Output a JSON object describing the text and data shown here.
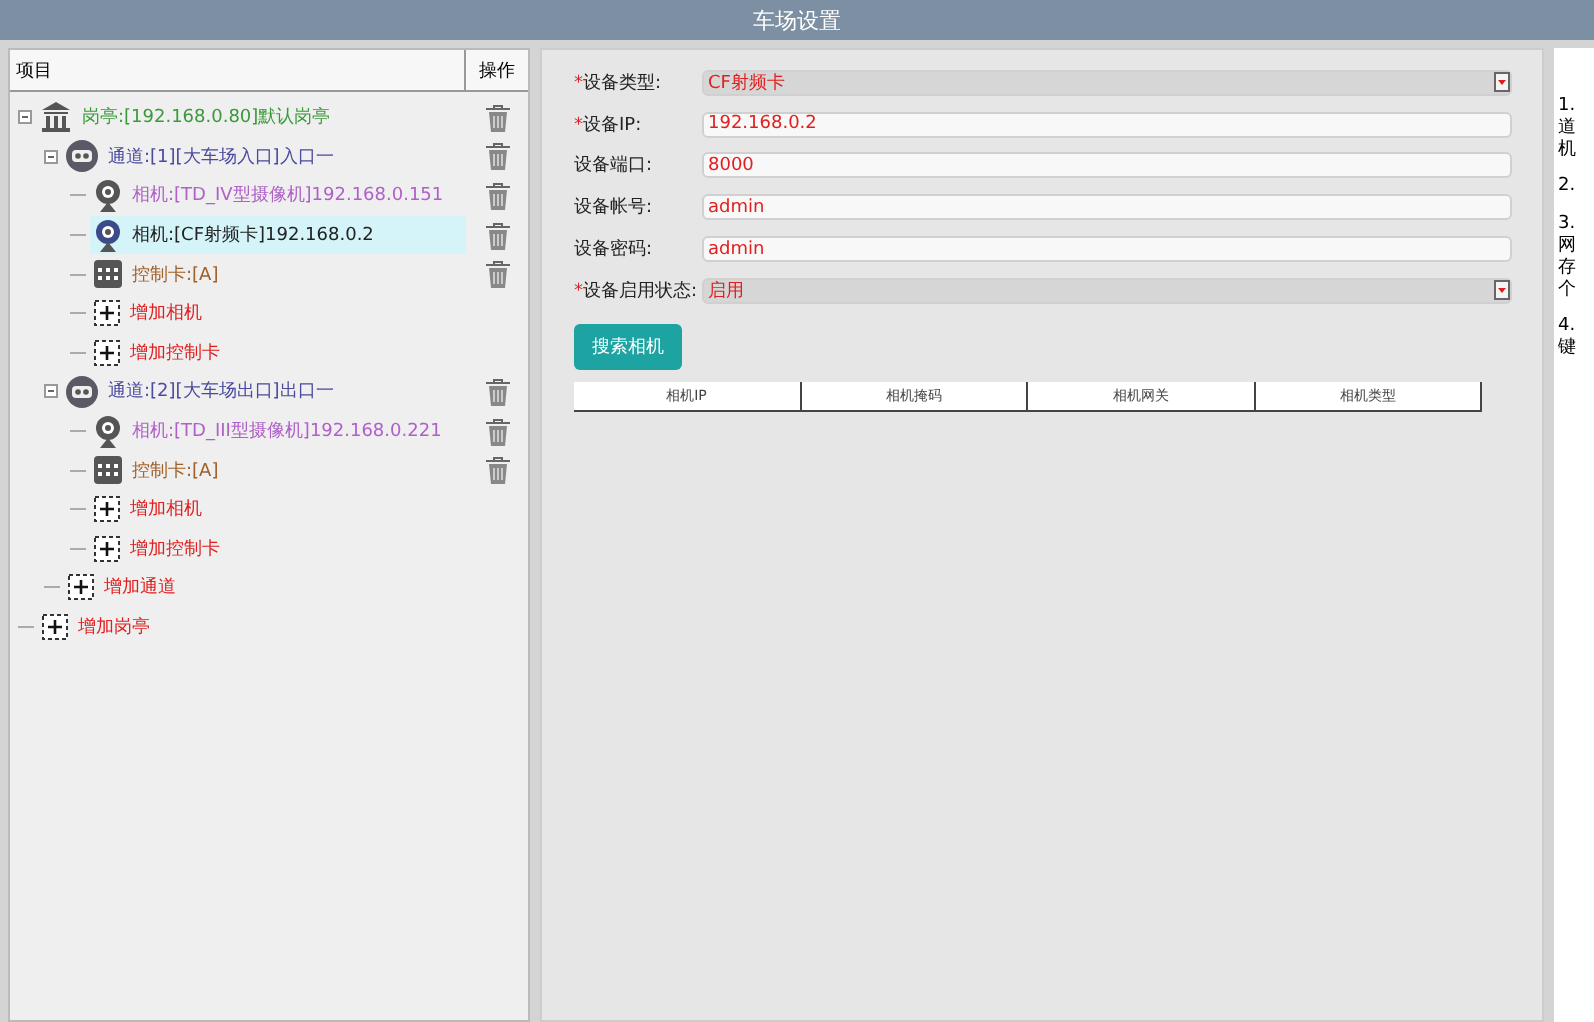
{
  "window": {
    "title": "车场设置"
  },
  "tree": {
    "columns": [
      "项目",
      "操作"
    ],
    "items": [
      {
        "kind": "booth",
        "label": "岗亭:[192.168.0.80]默认岗亭",
        "selected": false,
        "expanded": true,
        "children": [
          {
            "kind": "channel",
            "label": "通道:[1][大车场入口]入口一",
            "selected": false,
            "expanded": true,
            "children": [
              {
                "kind": "camera",
                "label": "相机:[TD_IV型摄像机]192.168.0.151",
                "selected": false
              },
              {
                "kind": "camera_selected",
                "label": "相机:[CF射频卡]192.168.0.2",
                "selected": true
              },
              {
                "kind": "card",
                "label": "控制卡:[A]",
                "selected": false
              },
              {
                "kind": "add",
                "label": "增加相机",
                "selected": false
              },
              {
                "kind": "add",
                "label": "增加控制卡",
                "selected": false
              }
            ]
          },
          {
            "kind": "channel",
            "label": "通道:[2][大车场出口]出口一",
            "selected": false,
            "expanded": true,
            "children": [
              {
                "kind": "camera",
                "label": "相机:[TD_III型摄像机]192.168.0.221",
                "selected": false
              },
              {
                "kind": "card",
                "label": "控制卡:[A]",
                "selected": false
              },
              {
                "kind": "add",
                "label": "增加相机",
                "selected": false
              },
              {
                "kind": "add",
                "label": "增加控制卡",
                "selected": false
              }
            ]
          },
          {
            "kind": "add",
            "label": "增加通道",
            "selected": false
          }
        ]
      },
      {
        "kind": "add",
        "label": "增加岗亭",
        "selected": false
      }
    ]
  },
  "form": {
    "fields": [
      {
        "kind": "select",
        "required_mark": "*",
        "label": "设备类型:",
        "value": "CF射频卡"
      },
      {
        "kind": "input",
        "required_mark": "*",
        "label": "设备IP:",
        "value": "192.168.0.2"
      },
      {
        "kind": "input",
        "label": "设备端口:",
        "value": "8000"
      },
      {
        "kind": "input",
        "label": "设备帐号:",
        "value": "admin"
      },
      {
        "kind": "input",
        "label": "设备密码:",
        "value": "admin"
      },
      {
        "kind": "select",
        "required_mark": "*",
        "label": "设备启用状态:",
        "value": "启用"
      }
    ],
    "search_button": "搜索相机",
    "table": {
      "columns": [
        "相机IP",
        "相机掩码",
        "相机网关",
        "相机类型"
      ]
    }
  },
  "notes": [
    [
      "1.",
      "道",
      "机"
    ],
    [
      "2."
    ],
    [
      "3.",
      "网",
      "存",
      "个"
    ],
    [
      "4.",
      "键"
    ]
  ]
}
